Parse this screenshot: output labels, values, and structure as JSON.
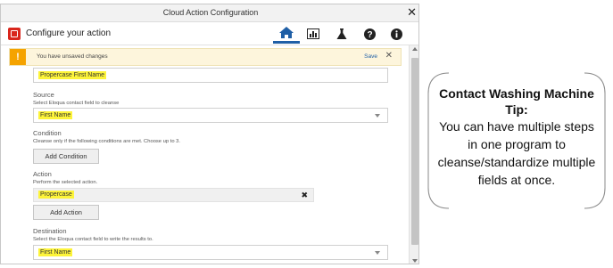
{
  "window": {
    "title": "Cloud Action Configuration",
    "close": "✕"
  },
  "header": {
    "title": "Configure your action",
    "icons": [
      "home-icon",
      "chart-icon",
      "flask-icon",
      "help-icon",
      "info-icon"
    ],
    "active_icon": "home-icon",
    "accent": "#1f5fa6",
    "brand": "#d9261c"
  },
  "alert": {
    "icon": "!",
    "message": "You have unsaved changes",
    "save_label": "Save",
    "dismiss": "✕"
  },
  "form": {
    "step_name_value": "Propercase First Name",
    "source": {
      "label": "Source",
      "help": "Select Eloqua contact field to cleanse",
      "value": "First Name"
    },
    "condition": {
      "label": "Condition",
      "help": "Cleanse only if the following conditions are met. Choose up to 3.",
      "button": "Add Condition"
    },
    "action": {
      "label": "Action",
      "help": "Perform the selected action.",
      "value": "Propercase",
      "remove": "✖",
      "button": "Add Action"
    },
    "destination": {
      "label": "Destination",
      "help": "Select the Eloqua contact field to write the results to.",
      "value": "First Name"
    }
  },
  "tip": {
    "title": "Contact Washing Machine Tip:",
    "body": "You can have multiple steps in one program to cleanse/standardize multiple fields at once."
  }
}
